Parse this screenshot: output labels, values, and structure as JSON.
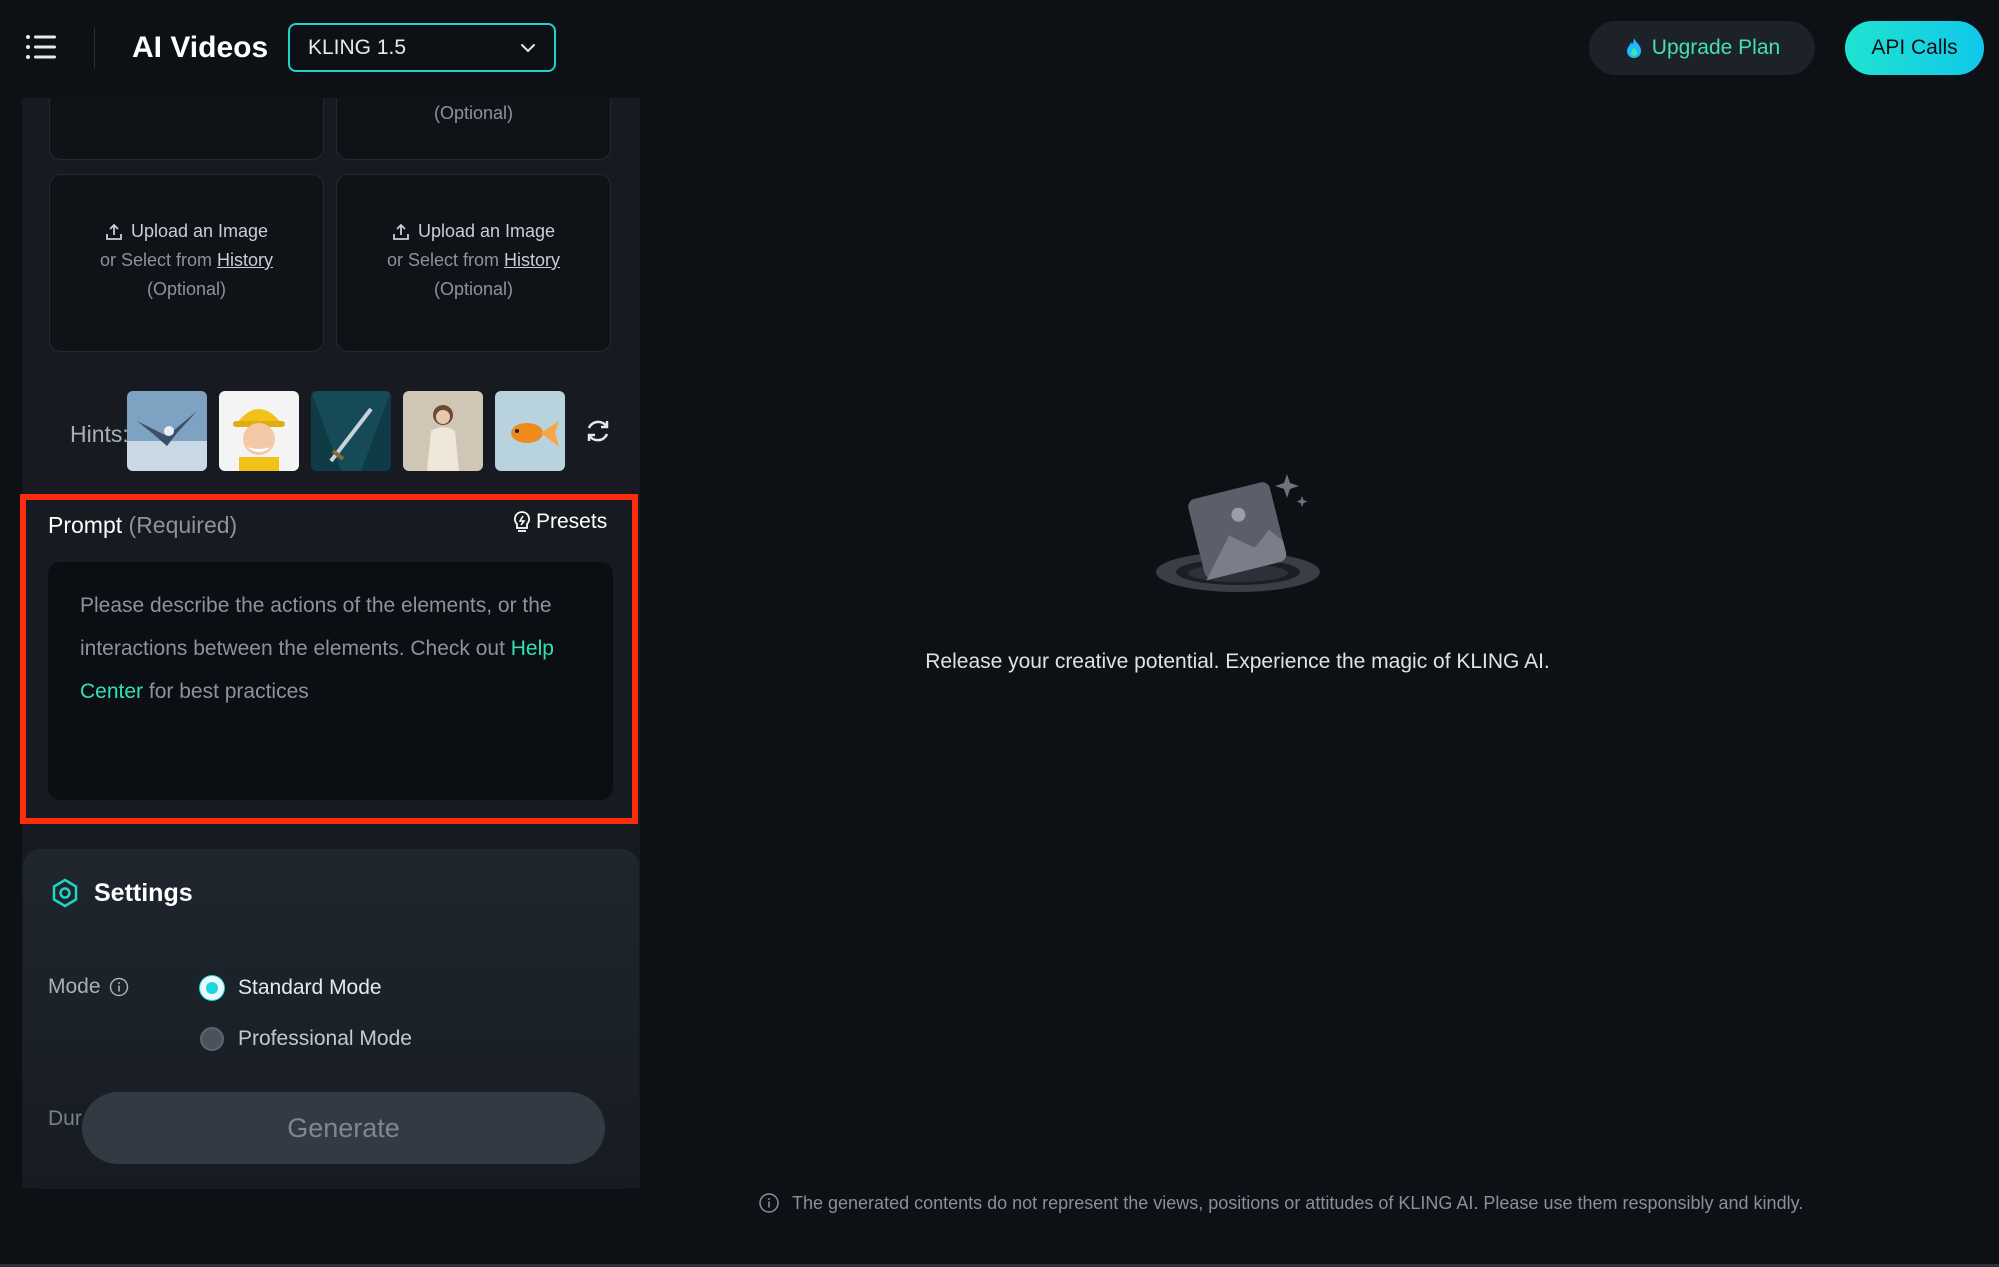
{
  "header": {
    "app_title": "AI Videos",
    "model_select": "KLING 1.5",
    "upgrade_label": "Upgrade Plan",
    "api_label": "API Calls"
  },
  "uploads": {
    "top_optional": "(Optional)",
    "cards": [
      {
        "main": "Upload an Image",
        "secondary": "or Select from",
        "link": "History",
        "optional": "(Optional)"
      },
      {
        "main": "Upload an Image",
        "secondary": "or Select from",
        "link": "History",
        "optional": "(Optional)"
      }
    ]
  },
  "hints": {
    "label": "Hints:",
    "items": [
      "eagle-thumbnail",
      "cartoon-worker-thumbnail",
      "sword-thumbnail",
      "woman-portrait-thumbnail",
      "goldfish-thumbnail"
    ]
  },
  "prompt": {
    "label": "Prompt",
    "required": "(Required)",
    "presets": "Presets",
    "placeholder_text": "Please describe the actions of the elements, or the interactions between the elements. Check out",
    "help_link": "Help Center",
    "placeholder_tail": "for best practices"
  },
  "settings": {
    "title": "Settings",
    "mode_label": "Mode",
    "modes": [
      {
        "label": "Standard Mode",
        "selected": true
      },
      {
        "label": "Professional Mode",
        "selected": false
      }
    ],
    "duration_label": "Dur",
    "generate_label": "Generate"
  },
  "main": {
    "empty_text": "Release your creative potential. Experience the magic of KLING AI.",
    "footer_note": "The generated contents do not represent the views, positions or attitudes of KLING AI. Please use them responsibly and kindly."
  },
  "colors": {
    "accent": "#22d3c5",
    "link": "#33e0b8",
    "highlight": "#ff2b0f",
    "background": "#0d1015"
  }
}
